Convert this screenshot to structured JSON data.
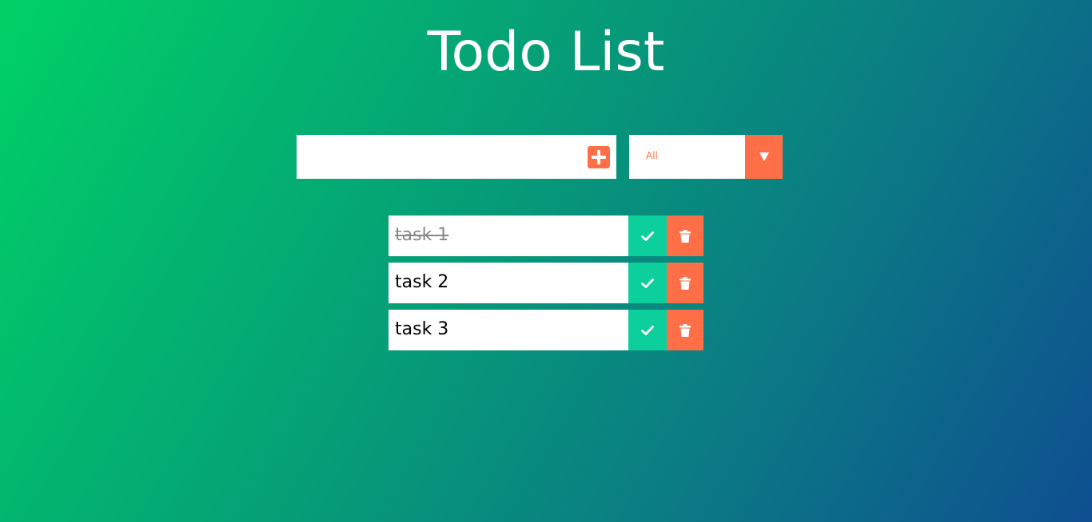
{
  "header": {
    "title": "Todo List"
  },
  "add_form": {
    "input_value": "",
    "input_placeholder": "",
    "add_icon": "plus-square-icon"
  },
  "filter": {
    "selected": "All",
    "options": [
      "All"
    ],
    "arrow_icon": "caret-down-icon"
  },
  "todos": [
    {
      "text": "task 1",
      "completed": true
    },
    {
      "text": "task 2",
      "completed": false
    },
    {
      "text": "task 3",
      "completed": false
    }
  ],
  "colors": {
    "accent": "#ff6f47",
    "complete": "#0ccf9b",
    "gradient_start": "#00d166",
    "gradient_end": "#0e4f90"
  }
}
